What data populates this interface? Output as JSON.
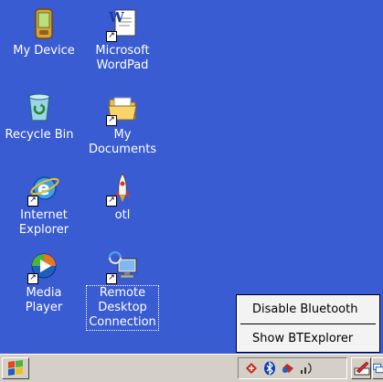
{
  "desktop": {
    "icons": [
      {
        "label": "My Device",
        "icon": "pda-icon",
        "shortcut": false
      },
      {
        "label": "Microsoft\nWordPad",
        "icon": "wordpad-icon",
        "shortcut": true
      },
      {
        "label": "Recycle Bin",
        "icon": "recycle-bin-icon",
        "shortcut": false
      },
      {
        "label": "My\nDocuments",
        "icon": "folder-icon",
        "shortcut": true
      },
      {
        "label": "Internet\nExplorer",
        "icon": "ie-icon",
        "shortcut": true
      },
      {
        "label": "otl",
        "icon": "rocket-icon",
        "shortcut": true
      },
      {
        "label": "Media\nPlayer",
        "icon": "media-player-icon",
        "shortcut": true
      },
      {
        "label": "Remote\nDesktop\nConnection",
        "icon": "remote-desktop-icon",
        "shortcut": true
      }
    ]
  },
  "context_menu": {
    "items": [
      "Disable Bluetooth",
      "Show BTExplorer"
    ]
  },
  "taskbar": {
    "start_icon": "windows-flag-icon",
    "tray_icons": [
      "bluetooth-stack-icon",
      "bluetooth-icon",
      "network-icon",
      "signal-icon"
    ],
    "buttons": [
      "pen-input-icon",
      "desktop-switch-icon"
    ]
  },
  "colors": {
    "desktop": "#3a5cd2",
    "taskbar": "#d4d0c8",
    "menu": "#f3f3f3"
  }
}
